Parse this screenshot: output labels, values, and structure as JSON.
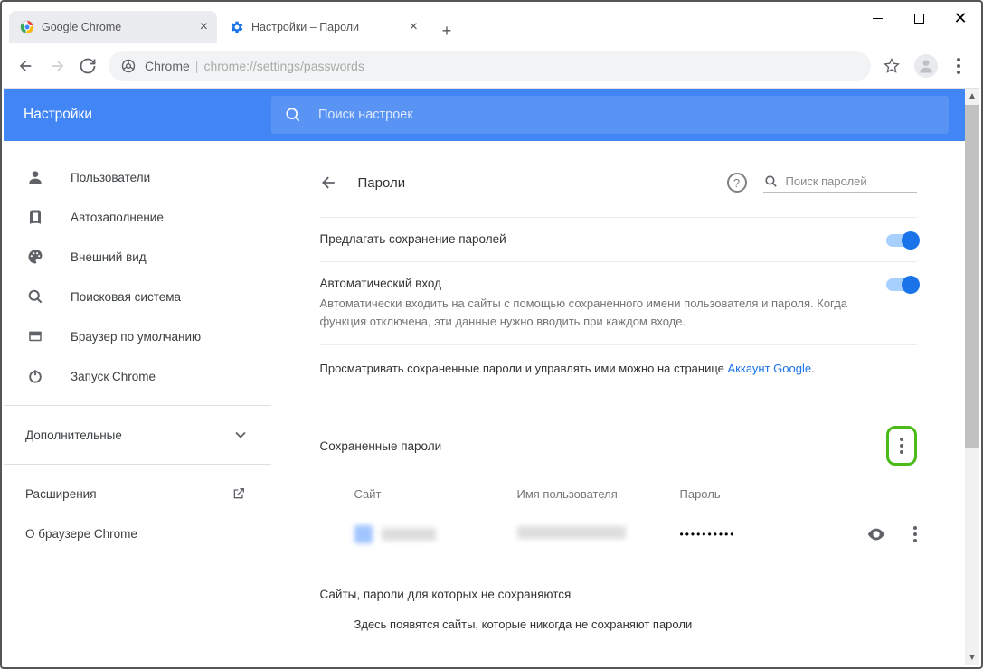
{
  "window": {
    "tabs": [
      {
        "label": "Google Chrome"
      },
      {
        "label": "Настройки – Пароли"
      }
    ]
  },
  "omnibox": {
    "chrome_label": "Chrome",
    "path": "chrome://settings/passwords"
  },
  "header": {
    "title": "Настройки",
    "search_placeholder": "Поиск настроек"
  },
  "sidebar": {
    "items": [
      {
        "label": "Пользователи",
        "icon": "person-icon"
      },
      {
        "label": "Автозаполнение",
        "icon": "autofill-icon"
      },
      {
        "label": "Внешний вид",
        "icon": "palette-icon"
      },
      {
        "label": "Поисковая система",
        "icon": "search-icon"
      },
      {
        "label": "Браузер по умолчанию",
        "icon": "browser-icon"
      },
      {
        "label": "Запуск Chrome",
        "icon": "power-icon"
      }
    ],
    "advanced": "Дополнительные",
    "extensions": "Расширения",
    "about": "О браузере Chrome"
  },
  "page": {
    "title": "Пароли",
    "search_placeholder": "Поиск паролей",
    "offer_save": {
      "label": "Предлагать сохранение паролей"
    },
    "auto_signin": {
      "label": "Автоматический вход",
      "desc": "Автоматически входить на сайты с помощью сохраненного имени пользователя и пароля. Когда функция отключена, эти данные нужно вводить при каждом входе."
    },
    "manage_text": "Просматривать сохраненные пароли и управлять ими можно на странице ",
    "manage_link": "Аккаунт Google",
    "saved_passwords_title": "Сохраненные пароли",
    "columns": {
      "site": "Сайт",
      "username": "Имя пользователя",
      "password": "Пароль"
    },
    "row1": {
      "password": "••••••••••"
    },
    "excluded_title": "Сайты, пароли для которых не сохраняются",
    "excluded_empty": "Здесь появятся сайты, которые никогда не сохраняют пароли"
  }
}
